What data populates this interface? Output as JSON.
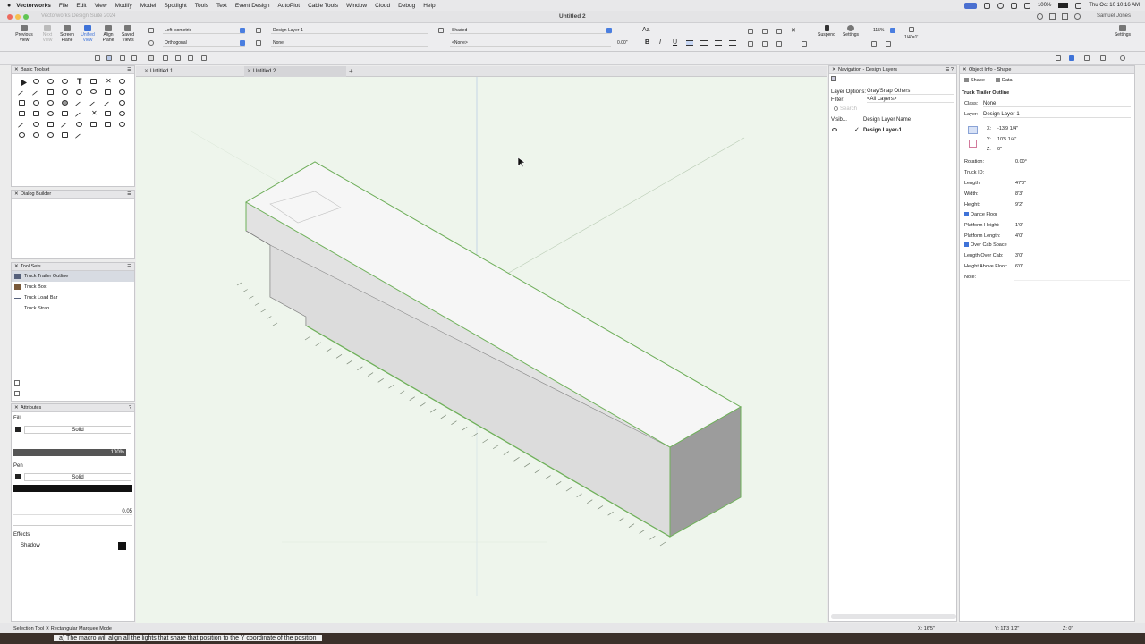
{
  "menubar": {
    "app": "Vectorworks",
    "items": [
      "File",
      "Edit",
      "View",
      "Modify",
      "Model",
      "Spotlight",
      "Tools",
      "Text",
      "Event Design",
      "AutoPlot",
      "Cable Tools",
      "Window",
      "Cloud",
      "Debug",
      "Help"
    ],
    "battery": "100%",
    "clock": "Thu Oct 10  10:16 AM"
  },
  "window": {
    "app_title": "Vectorworks Design Suite 2024",
    "doc_title": "Untitled 2",
    "user": "Samuel Jones"
  },
  "toolbar": {
    "previous_view": "Previous View",
    "next_view": "Next View",
    "screen_plane": "Screen Plane",
    "unified_view": "Unified View",
    "align_plane": "Align Plane",
    "saved_views": "Saved Views",
    "view_value": "Left Isometric",
    "projection_value": "Orthogonal",
    "layer_value": "Design Layer-1",
    "class_value": "None",
    "render_value": "Shaded",
    "render_sub_value": "<None>",
    "text_size": "0.00\"",
    "suspend": "Suspend",
    "settings_left": "Settings",
    "zoom": "115%",
    "scale": "1/4\"=1'",
    "settings_right": "Settings"
  },
  "tabs": [
    {
      "label": "Untitled 1"
    },
    {
      "label": "Untitled 2"
    }
  ],
  "basic_toolset": {
    "title": "Basic Toolset"
  },
  "dialog_builder": {
    "title": "Dialog Builder"
  },
  "tool_sets": {
    "title": "Tool Sets",
    "items": [
      "Truck Trailer Outline",
      "Truck Box",
      "Truck Load Bar",
      "Truck Strap"
    ]
  },
  "attributes": {
    "title": "Attributes",
    "fill_label": "Fill",
    "fill_style": "Solid",
    "opacity": "100%",
    "pen_label": "Pen",
    "pen_style": "Solid",
    "line_weight": "0.05",
    "effects_label": "Effects",
    "shadow_label": "Shadow"
  },
  "navigation": {
    "title": "Navigation - Design Layers",
    "layer_options_label": "Layer Options:",
    "layer_options_value": "Gray/Snap Others",
    "filter_label": "Filter:",
    "filter_value": "<All Layers>",
    "search_placeholder": "Search",
    "col_visibility": "Visib...",
    "col_name": "Design Layer Name",
    "layers": [
      "Design Layer-1"
    ]
  },
  "object_info": {
    "title": "Object Info - Shape",
    "tab_shape": "Shape",
    "tab_data": "Data",
    "object_name": "Truck Trailer Outline",
    "class_label": "Class:",
    "class_value": "None",
    "layer_label": "Layer:",
    "layer_value": "Design Layer-1",
    "x_label": "X:",
    "x_value": "-13'9 1/4\"",
    "y_label": "Y:",
    "y_value": "10'5 1/4\"",
    "z_label": "Z:",
    "z_value": "0\"",
    "fields": [
      {
        "label": "Rotation:",
        "value": "0.00°"
      },
      {
        "label": "Truck ID:",
        "value": ""
      },
      {
        "label": "Length:",
        "value": "47'0\""
      },
      {
        "label": "Width:",
        "value": "8'3\""
      },
      {
        "label": "Height:",
        "value": "9'2\""
      }
    ],
    "dance_floor": "Dance Floor",
    "platform_height_label": "Platform Height:",
    "platform_height_value": "1'0\"",
    "platform_length_label": "Platform Length:",
    "platform_length_value": "4'0\"",
    "over_cab": "Over Cab Space",
    "length_over_cab_label": "Length Over Cab:",
    "length_over_cab_value": "3'0\"",
    "height_above_floor_label": "Height Above Floor:",
    "height_above_floor_value": "6'0\"",
    "note_label": "Note:"
  },
  "status": {
    "left": "Selection Tool  ✕  Rectangular Marquee Mode",
    "x": "X: 16'5\"",
    "y": "Y: 11'3 1/2\"",
    "z": "Z: 0\""
  },
  "caption": "a)  The macro will align all the lights that share that position to the Y coordinate of the position",
  "colors": {
    "accent": "#3f73d8",
    "canvas": "#eef5ec",
    "selection": "#6fb15a"
  }
}
